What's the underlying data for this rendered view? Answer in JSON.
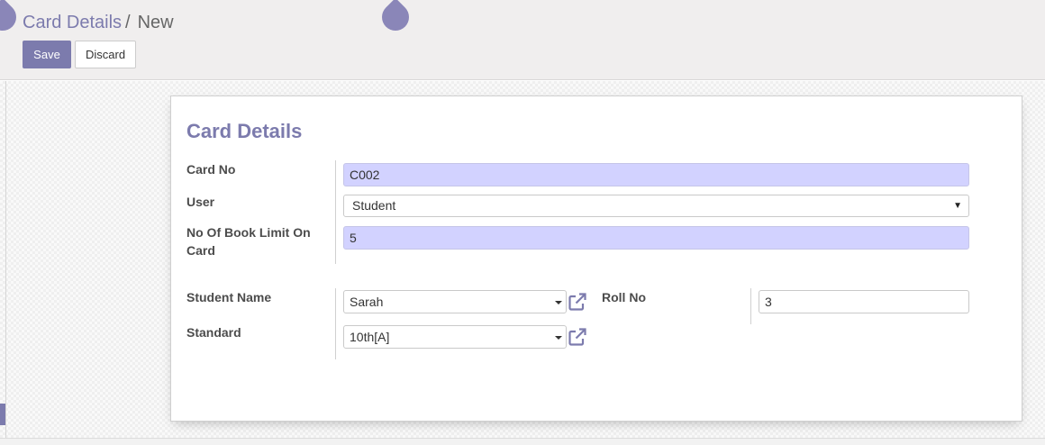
{
  "breadcrumb": {
    "parent": "Card Details",
    "separator": "/",
    "current": "New"
  },
  "toolbar": {
    "save_label": "Save",
    "discard_label": "Discard"
  },
  "form": {
    "title": "Card Details",
    "fields": {
      "card_no": {
        "label": "Card No",
        "value": "C002"
      },
      "user": {
        "label": "User",
        "value": "Student"
      },
      "book_limit": {
        "label_line1": "No Of Book Limit On",
        "label_line2": "Card",
        "value": "5"
      },
      "student_name": {
        "label": "Student Name",
        "value": "Sarah"
      },
      "roll_no": {
        "label": "Roll No",
        "value": "3"
      },
      "standard": {
        "label": "Standard",
        "value": "10th[A]"
      }
    }
  },
  "colors": {
    "accent": "#7c7bad",
    "required_field_bg": "#d2d2ff",
    "panel_bg": "#f0eeee"
  },
  "icons": {
    "external_link": "external-link-icon",
    "dropdown": "caret-down-icon"
  }
}
